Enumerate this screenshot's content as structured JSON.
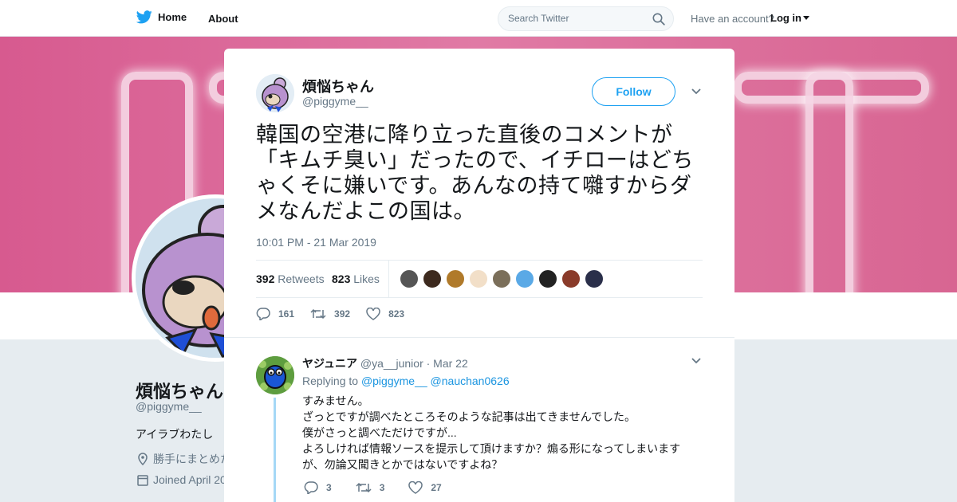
{
  "nav": {
    "home_label": "Home",
    "about_label": "About",
    "search_placeholder": "Search Twitter",
    "have_account": "Have an account?",
    "login_label": "Log in"
  },
  "profile": {
    "name": "煩悩ちゃん",
    "handle": "@piggyme__",
    "bio": "アイラブわたし",
    "location": "勝手にまとめた",
    "joined": "Joined April 20"
  },
  "tweet": {
    "author_name": "煩悩ちゃん",
    "author_handle": "@piggyme__",
    "follow_label": "Follow",
    "text": "韓国の空港に降り立った直後のコメントが「キムチ臭い」だったので、イチローはどちゃくそに嫌いです。あんなの持て囃すからダメなんだよこの国は。",
    "timestamp": "10:01 PM - 21 Mar 2019",
    "retweets_count": "392",
    "retweets_label": "Retweets",
    "likes_count": "823",
    "likes_label": "Likes",
    "reply_count": "161",
    "retweet_action_count": "392",
    "like_action_count": "823",
    "liker_colors": [
      "#555555",
      "#3d2a1e",
      "#b07a2a",
      "#f2dfc8",
      "#7b6f5a",
      "#5aa9e6",
      "#222222",
      "#8a3b2a",
      "#2a2f4a"
    ]
  },
  "reply": {
    "name": "ヤジュニア",
    "handle": "@ya__junior",
    "date": "· Mar 22",
    "replying_to_label": "Replying to",
    "mention_1": "@piggyme__",
    "mention_2": "@nauchan0626",
    "text": "すみません。\nざっとですが調べたところそのような記事は出てきませんでした。\n僕がさっと調べただけですが...\nよろしければ情報ソースを提示して頂けますか？煽る形になってしまいますが、勿論又聞きとかではないですよね？",
    "reply_count": "3",
    "retweet_count": "3",
    "like_count": "27"
  },
  "colors": {
    "accent": "#1da1f2",
    "banner": "#d75a8f"
  }
}
